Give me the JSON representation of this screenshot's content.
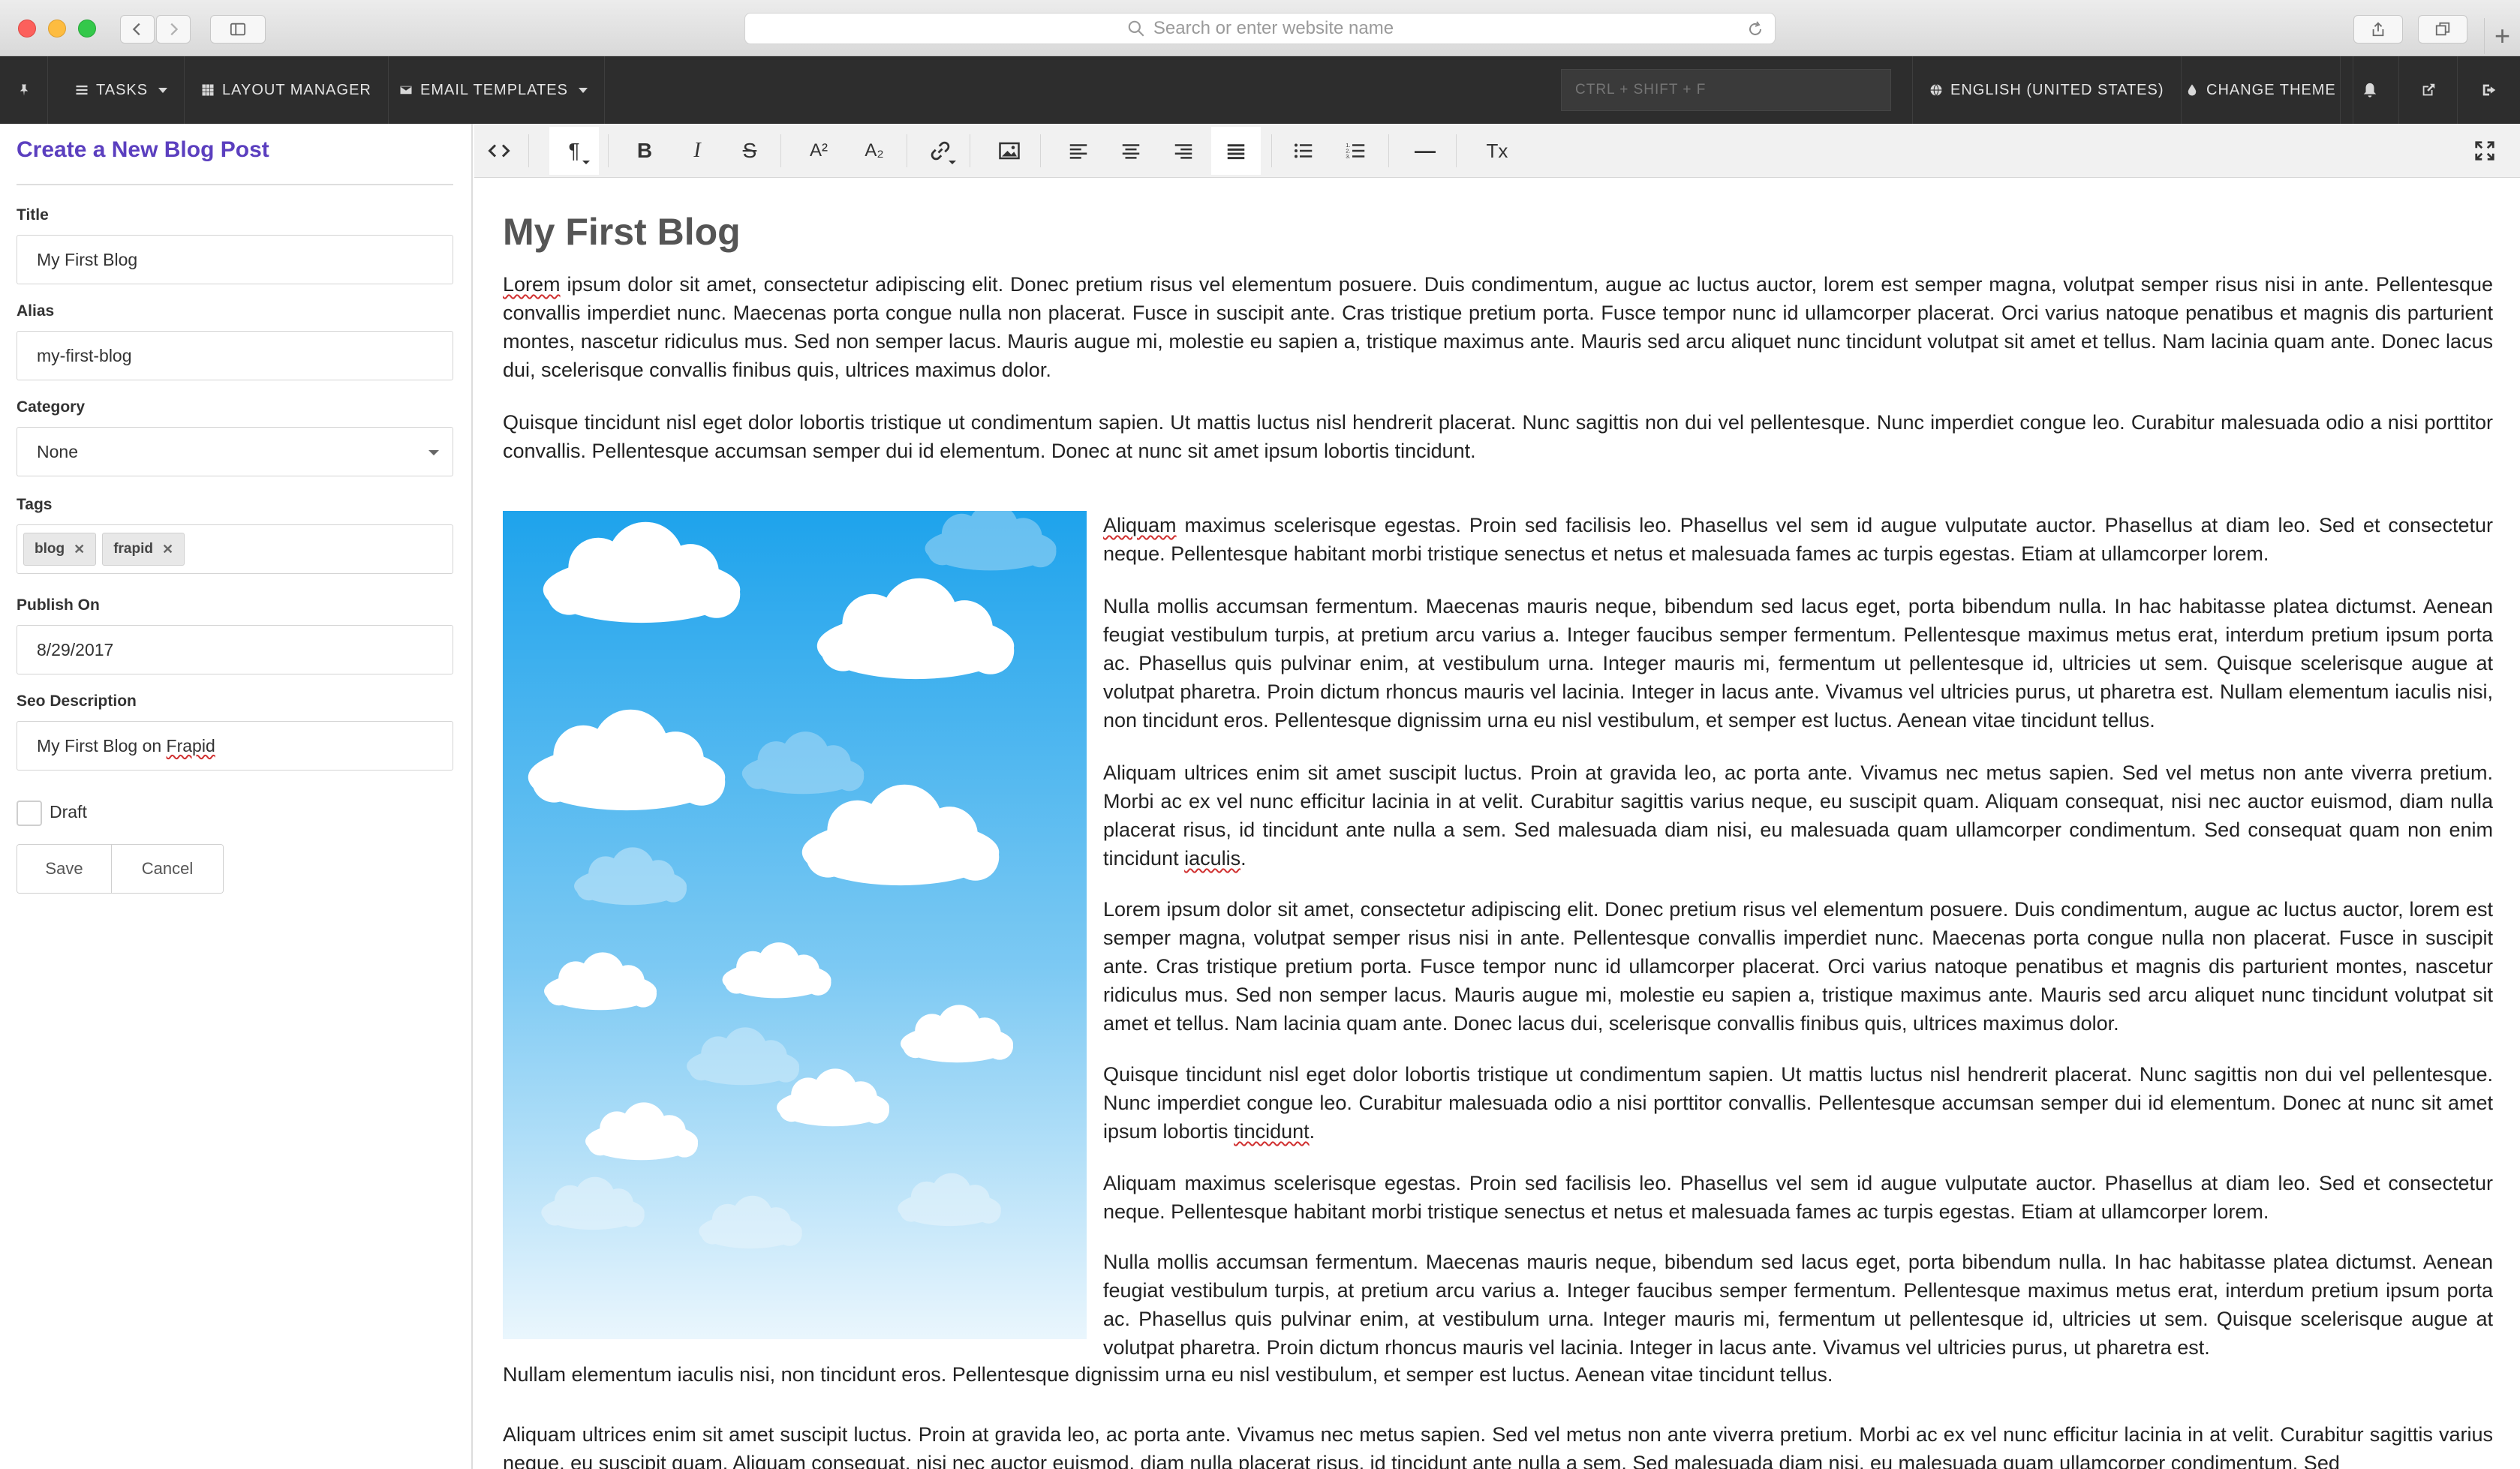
{
  "browser": {
    "address_placeholder": "Search or enter website name"
  },
  "topbar": {
    "tasks": "TASKS",
    "layout_manager": "LAYOUT MANAGER",
    "email_templates": "EMAIL TEMPLATES",
    "search_placeholder": "CTRL + SHIFT + F",
    "language": "ENGLISH (UNITED STATES)",
    "change_theme": "CHANGE THEME"
  },
  "form": {
    "title": "Create a New Blog Post",
    "title_label": "Title",
    "title_value": "My First Blog",
    "alias_label": "Alias",
    "alias_value": "my-first-blog",
    "category_label": "Category",
    "category_value": "None",
    "tags_label": "Tags",
    "tags": [
      "blog",
      "frapid"
    ],
    "publish_label": "Publish On",
    "publish_value": "8/29/2017",
    "seo_label": "Seo Description",
    "seo_value_prefix": "My First Blog on ",
    "seo_value_word": "Frapid",
    "draft_label": "Draft",
    "save_label": "Save",
    "cancel_label": "Cancel"
  },
  "toolbar": {
    "paragraph": "¶",
    "bold": "B",
    "italic": "I",
    "strike": "S",
    "superscript": "A²",
    "subscript": "A₂",
    "hr": "—",
    "clear": "Tx"
  },
  "doc": {
    "title": "My First Blog",
    "p1_first": "Lorem",
    "p1_rest": " ipsum dolor sit amet, consectetur adipiscing elit. Donec pretium risus vel elementum posuere. Duis condimentum, augue ac luctus auctor, lorem est semper magna, volutpat semper risus nisi in ante. Pellentesque convallis imperdiet nunc. Maecenas porta congue nulla non placerat. Fusce in suscipit ante. Cras tristique pretium porta. Fusce tempor nunc id ullamcorper placerat. Orci varius natoque penatibus et magnis dis parturient montes, nascetur ridiculus mus. Sed non semper lacus. Mauris augue mi, molestie eu sapien a, tristique maximus ante. Mauris sed arcu aliquet nunc tincidunt volutpat sit amet et tellus. Nam lacinia quam ante. Donec lacus dui, scelerisque convallis finibus quis, ultrices maximus dolor.",
    "p2": "Quisque tincidunt nisl eget dolor lobortis tristique ut condimentum sapien. Ut mattis luctus nisl hendrerit placerat. Nunc sagittis non dui vel pellentesque. Nunc imperdiet congue leo. Curabitur malesuada odio a nisi porttitor convallis. Pellentesque accumsan semper dui id elementum. Donec at nunc sit amet ipsum lobortis tincidunt.",
    "s1_first": "Aliquam",
    "s1_rest": " maximus scelerisque egestas. Proin sed facilisis leo. Phasellus vel sem id augue vulputate auctor. Phasellus at diam leo. Sed et consectetur neque. Pellentesque habitant morbi tristique senectus et netus et malesuada fames ac turpis egestas. Etiam at ullamcorper lorem.",
    "s2": "Nulla mollis accumsan fermentum. Maecenas mauris neque, bibendum sed lacus eget, porta bibendum nulla. In hac habitasse platea dictumst. Aenean feugiat vestibulum turpis, at pretium arcu varius a. Integer faucibus semper fermentum. Pellentesque maximus metus erat, interdum pretium ipsum porta ac. Phasellus quis pulvinar enim, at vestibulum urna. Integer mauris mi, fermentum ut pellentesque id, ultricies ut sem. Quisque scelerisque augue at volutpat pharetra. Proin dictum rhoncus mauris vel lacinia. Integer in lacus ante. Vivamus vel ultricies purus, ut pharetra est. Nullam elementum iaculis nisi, non tincidunt eros. Pellentesque dignissim urna eu nisl vestibulum, et semper est luctus. Aenean vitae tincidunt tellus.",
    "s3_main": "Aliquam ultrices enim sit amet suscipit luctus. Proin at gravida leo, ac porta ante. Vivamus nec metus sapien. Sed vel metus non ante viverra pretium. Morbi ac ex vel nunc efficitur lacinia in at velit. Curabitur sagittis varius neque, eu suscipit quam. Aliquam consequat, nisi nec auctor euismod, diam nulla placerat risus, id tincidunt ante nulla a sem. Sed malesuada diam nisi, eu malesuada quam ullamcorper condimentum. Sed consequat quam non enim tincidunt ",
    "s3_word": "iaculis",
    "s4": "Lorem ipsum dolor sit amet, consectetur adipiscing elit. Donec pretium risus vel elementum posuere. Duis condimentum, augue ac luctus auctor, lorem est semper magna, volutpat semper risus nisi in ante. Pellentesque convallis imperdiet nunc. Maecenas porta congue nulla non placerat. Fusce in suscipit ante. Cras tristique pretium porta. Fusce tempor nunc id ullamcorper placerat. Orci varius natoque penatibus et magnis dis parturient montes, nascetur ridiculus mus. Sed non semper lacus. Mauris augue mi, molestie eu sapien a, tristique maximus ante. Mauris sed arcu aliquet nunc tincidunt volutpat sit amet et tellus. Nam lacinia quam ante. Donec lacus dui, scelerisque convallis finibus quis, ultrices maximus dolor.",
    "s5_main": "Quisque tincidunt nisl eget dolor lobortis tristique ut condimentum sapien. Ut mattis luctus nisl hendrerit placerat. Nunc sagittis non dui vel pellentesque. Nunc imperdiet congue leo. Curabitur malesuada odio a nisi porttitor convallis. Pellentesque accumsan semper dui id elementum. Donec at nunc sit amet ipsum lobortis ",
    "s5_word": "tincidunt",
    "s6": "Aliquam maximus scelerisque egestas. Proin sed facilisis leo. Phasellus vel sem id augue vulputate auctor. Phasellus at diam leo. Sed et consectetur neque. Pellentesque habitant morbi tristique senectus et netus et malesuada fames ac turpis egestas. Etiam at ullamcorper lorem.",
    "s7": "Nulla mollis accumsan fermentum. Maecenas mauris neque, bibendum sed lacus eget, porta bibendum nulla. In hac habitasse platea dictumst. Aenean feugiat vestibulum turpis, at pretium arcu varius a. Integer faucibus semper fermentum. Pellentesque maximus metus erat, interdum pretium ipsum porta ac. Phasellus quis pulvinar enim, at vestibulum urna. Integer mauris mi, fermentum ut pellentesque id, ultricies ut sem. Quisque scelerisque augue at volutpat pharetra. Proin dictum rhoncus mauris vel lacinia. Integer in lacus ante. Vivamus vel ultricies purus, ut pharetra est.",
    "f1": "Nullam elementum iaculis nisi, non tincidunt eros. Pellentesque dignissim urna eu nisl vestibulum, et semper est luctus. Aenean vitae tincidunt tellus.",
    "f2": "Aliquam ultrices enim sit amet suscipit luctus. Proin at gravida leo, ac porta ante. Vivamus nec metus sapien. Sed vel metus non ante viverra pretium. Morbi ac ex vel nunc efficitur lacinia in at velit. Curabitur sagittis varius neque, eu suscipit quam. Aliquam consequat, nisi nec auctor euismod, diam nulla placerat risus, id tincidunt ante nulla a sem. Sed malesuada diam nisi, eu malesuada quam ullamcorper condimentum. Sed"
  },
  "colors": {
    "accent": "#5b3fbf",
    "topbar_bg": "#2d2d2d",
    "sky_top": "#1ea3ec",
    "sky_bottom": "#eaf6fd"
  }
}
